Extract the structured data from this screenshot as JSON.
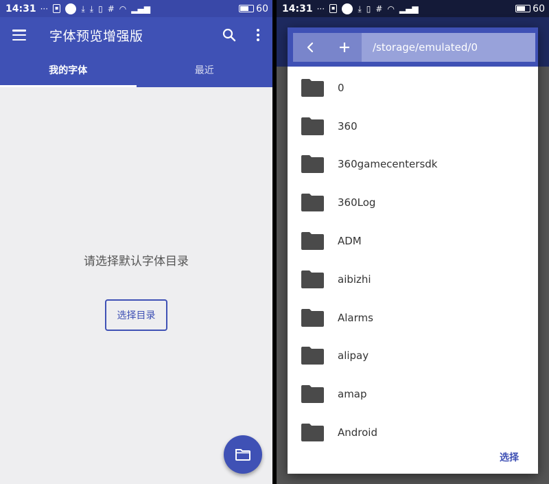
{
  "status": {
    "time": "14:31",
    "battery": "60"
  },
  "left": {
    "app_title": "字体预览增强版",
    "menu_icon": "menu-icon",
    "search_icon": "search-icon",
    "more_icon": "more-vert-icon",
    "tabs": [
      {
        "label": "我的字体",
        "active": true
      },
      {
        "label": "最近",
        "active": false
      }
    ],
    "empty_message": "请选择默认字体目录",
    "choose_dir_label": "选择目录",
    "fab_icon": "folder-icon"
  },
  "right": {
    "back_icon": "chevron-left-icon",
    "add_icon": "plus-icon",
    "path": "/storage/emulated/0",
    "folders": [
      "0",
      "360",
      "360gamecentersdk",
      "360Log",
      "ADM",
      "aibizhi",
      "Alarms",
      "alipay",
      "amap",
      "Android"
    ],
    "select_label": "选择"
  },
  "colors": {
    "primary": "#3f51b5",
    "left_background": "#eeeef0",
    "folder_icon": "#4a4a4a"
  }
}
